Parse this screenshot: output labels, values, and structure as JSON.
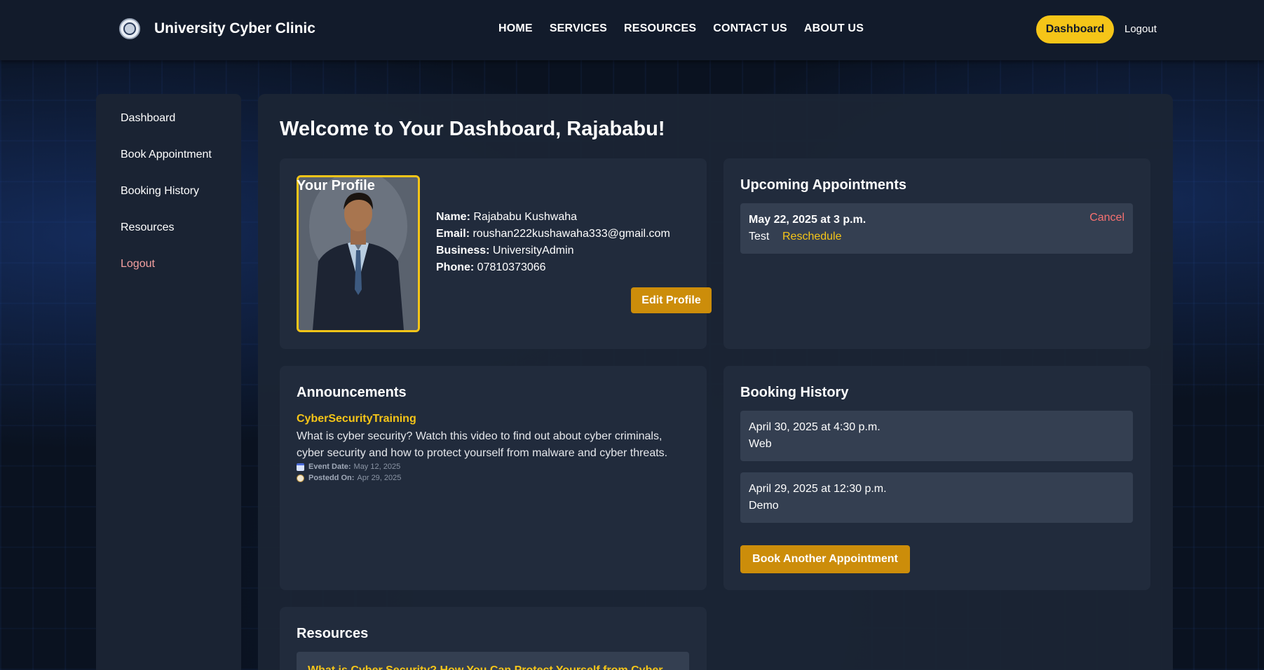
{
  "header": {
    "brand": "University Cyber Clinic",
    "nav": [
      "HOME",
      "SERVICES",
      "RESOURCES",
      "CONTACT US",
      "ABOUT US"
    ],
    "dashboard_button": "Dashboard",
    "logout": "Logout"
  },
  "sidebar": {
    "items": [
      "Dashboard",
      "Book Appointment",
      "Booking History",
      "Resources",
      "Logout"
    ]
  },
  "main": {
    "welcome": "Welcome to Your Dashboard, Rajababu!",
    "profile": {
      "title": "Your Profile",
      "name_label": "Name:",
      "name": "Rajababu Kushwaha",
      "email_label": "Email:",
      "email": "roushan222kushawaha333@gmail.com",
      "business_label": "Business:",
      "business": "UniversityAdmin",
      "phone_label": "Phone:",
      "phone": "07810373066",
      "edit_button": "Edit Profile"
    },
    "upcoming": {
      "title": "Upcoming Appointments",
      "items": [
        {
          "date": "May 22, 2025 at 3 p.m.",
          "service": "Test",
          "reschedule": "Reschedule",
          "cancel": "Cancel"
        }
      ]
    },
    "announcements": {
      "title": "Announcements",
      "items": [
        {
          "title": "CyberSecurityTraining",
          "body": "What is cyber security? Watch this video to find out about cyber criminals, cyber security and how to protect yourself from malware and cyber threats.",
          "event_label": "Event Date:",
          "event_date": "May 12, 2025",
          "posted_label": "Postedd On:",
          "posted_date": "Apr 29, 2025"
        }
      ]
    },
    "history": {
      "title": "Booking History",
      "items": [
        {
          "date": "April 30, 2025 at 4:30 p.m.",
          "service": "Web"
        },
        {
          "date": "April 29, 2025 at 12:30 p.m.",
          "service": "Demo"
        }
      ],
      "book_button": "Book Another Appointment"
    },
    "resources": {
      "title": "Resources",
      "items": [
        {
          "title": "What is Cyber Security? How You Can Protect Yourself from Cyber"
        }
      ]
    }
  },
  "colors": {
    "accent": "#f5c518",
    "button": "#cc8d0a",
    "cancel": "#f87171",
    "panel": "#212b3c"
  }
}
